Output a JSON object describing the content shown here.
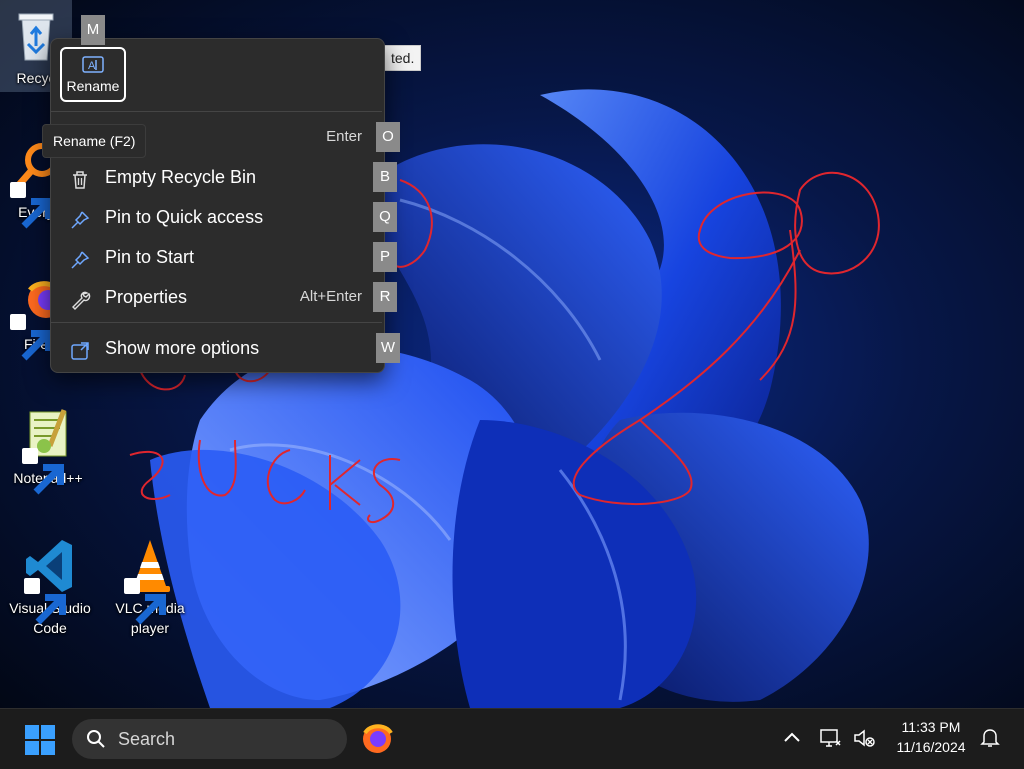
{
  "desktop": {
    "icons": [
      {
        "label": "Recyc",
        "name": "recycle-bin"
      },
      {
        "label": "Every",
        "name": "everything"
      },
      {
        "label": "Fire",
        "name": "firefox"
      },
      {
        "label": "Notepad++",
        "name": "notepad-plus-plus"
      },
      {
        "label": "Visual Studio Code",
        "name": "visual-studio-code"
      },
      {
        "label": "VLC media player",
        "name": "vlc-media-player"
      }
    ],
    "partial_tooltip": "ted."
  },
  "context_menu": {
    "rename_button": {
      "label": "Rename",
      "icon": "rename-icon"
    },
    "rename_tooltip": "Rename (F2)",
    "items": [
      {
        "label": "",
        "shortcut": "Enter",
        "access_key": "O",
        "icon": "open-icon"
      },
      {
        "label": "Empty Recycle Bin",
        "shortcut": "",
        "access_key": "B",
        "icon": "trash-icon"
      },
      {
        "label": "Pin to Quick access",
        "shortcut": "",
        "access_key": "Q",
        "icon": "pin-icon"
      },
      {
        "label": "Pin to Start",
        "shortcut": "",
        "access_key": "P",
        "icon": "pin-icon"
      },
      {
        "label": "Properties",
        "shortcut": "Alt+Enter",
        "access_key": "R",
        "icon": "wrench-icon"
      },
      {
        "label": "Show more options",
        "shortcut": "",
        "access_key": "W",
        "icon": "share-icon"
      }
    ],
    "rename_access_key": "M"
  },
  "taskbar": {
    "search_placeholder": "Search",
    "clock_time": "11:33 PM",
    "clock_date": "11/16/2024"
  },
  "colors": {
    "accent": "#0a66ff",
    "menu_bg": "#2c2c2c",
    "taskbar_bg": "#1c1c1c",
    "scribble": "#e0262e"
  }
}
